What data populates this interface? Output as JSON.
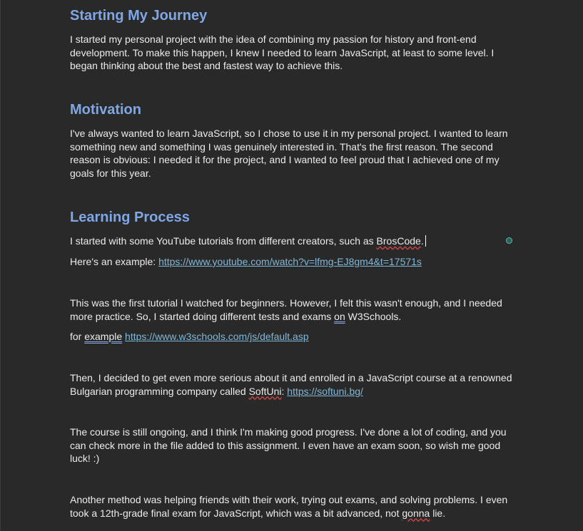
{
  "sections": {
    "journey": {
      "heading": "Starting My Journey",
      "body": "I started my personal project with the idea of combining my passion for history and front-end development. To make this happen, I knew I needed to learn JavaScript, at least to some level. I began thinking about the best and fastest way to achieve this."
    },
    "motivation": {
      "heading": "Motivation",
      "body": "I've always wanted to learn JavaScript, so I chose to use it in my personal project. I wanted to learn something new and something I was genuinely interested in. That's the first reason. The second reason is obvious: I needed it for the project, and I wanted to feel proud that I achieved one of my goals for this year."
    },
    "learning": {
      "heading": "Learning Process",
      "p1_text": "I started with some YouTube tutorials from different creators, such as ",
      "p1_name": "BrosCode",
      "p1_end": ".",
      "p2_prefix": "Here's an example: ",
      "p2_link": "https://www.youtube.com/watch?v=lfmg-EJ8gm4&t=17571s",
      "p3_a": " This was the first tutorial I watched for beginners. However, I felt this wasn't enough, and I needed more practice. So, I started doing different tests and exams ",
      "p3_on": "on",
      "p3_b": " W3Schools.",
      "p4_for": "for ",
      "p4_example": "example",
      "p4_space": " ",
      "p4_link": "https://www.w3schools.com/js/default.asp",
      "p5_a": "Then, I decided to get even more serious about it and enrolled in a JavaScript course at a renowned Bulgarian programming company called ",
      "p5_name": "SoftUni",
      "p5_colon": ": ",
      "p5_link": "https://softuni.bg/",
      "p6": " The course is still ongoing, and I think I'm making good progress. I've done a lot of coding, and you can check more in the file added to this assignment. I even have an exam soon, so wish me good luck! :)",
      "p7_a": "Another method was helping friends with their work, trying out exams, and solving problems. I even took a 12th-grade final exam for JavaScript, which was a bit advanced, not ",
      "p7_gonna": "gonna",
      "p7_b": " lie."
    }
  }
}
